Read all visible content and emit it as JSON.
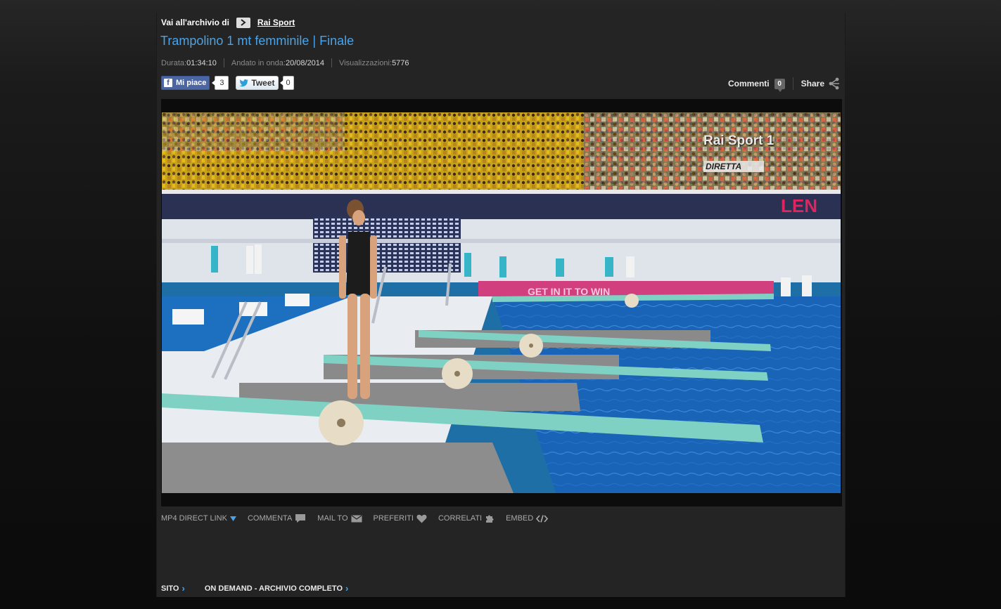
{
  "archive": {
    "prefix": "Vai all'archivio di",
    "link": "Rai Sport"
  },
  "video": {
    "title": "Trampolino 1 mt femminile | Finale",
    "meta": {
      "duration_label": "Durata:",
      "duration": "01:34:10",
      "aired_label": "Andato in onda:",
      "aired": "20/08/2014",
      "views_label": "Visualizzazioni:",
      "views": "5776"
    },
    "overlay": {
      "channel_rai": "Rai",
      "channel_sport": "Sport 1",
      "live": "DIRETTA"
    }
  },
  "social": {
    "like_label": "Mi piace",
    "like_count": "3",
    "tweet_label": "Tweet",
    "tweet_count": "0"
  },
  "tools": {
    "comments_label": "Commenti",
    "comments_count": "0",
    "share_label": "Share"
  },
  "actions": [
    {
      "label": "MP4 DIRECT LINK",
      "icon": "triangle-down-icon"
    },
    {
      "label": "COMMENTA",
      "icon": "speech-bubble-icon"
    },
    {
      "label": "MAIL TO",
      "icon": "envelope-icon"
    },
    {
      "label": "PREFERITI",
      "icon": "heart-icon"
    },
    {
      "label": "CORRELATI",
      "icon": "puzzle-icon"
    },
    {
      "label": "EMBED",
      "icon": "code-icon"
    }
  ],
  "bottom_links": [
    {
      "label": "SITO"
    },
    {
      "label": "ON DEMAND - ARCHIVIO COMPLETO"
    }
  ],
  "colors": {
    "accent": "#4aa3e8",
    "panel": "#242424",
    "facebook": "#3b5998"
  }
}
